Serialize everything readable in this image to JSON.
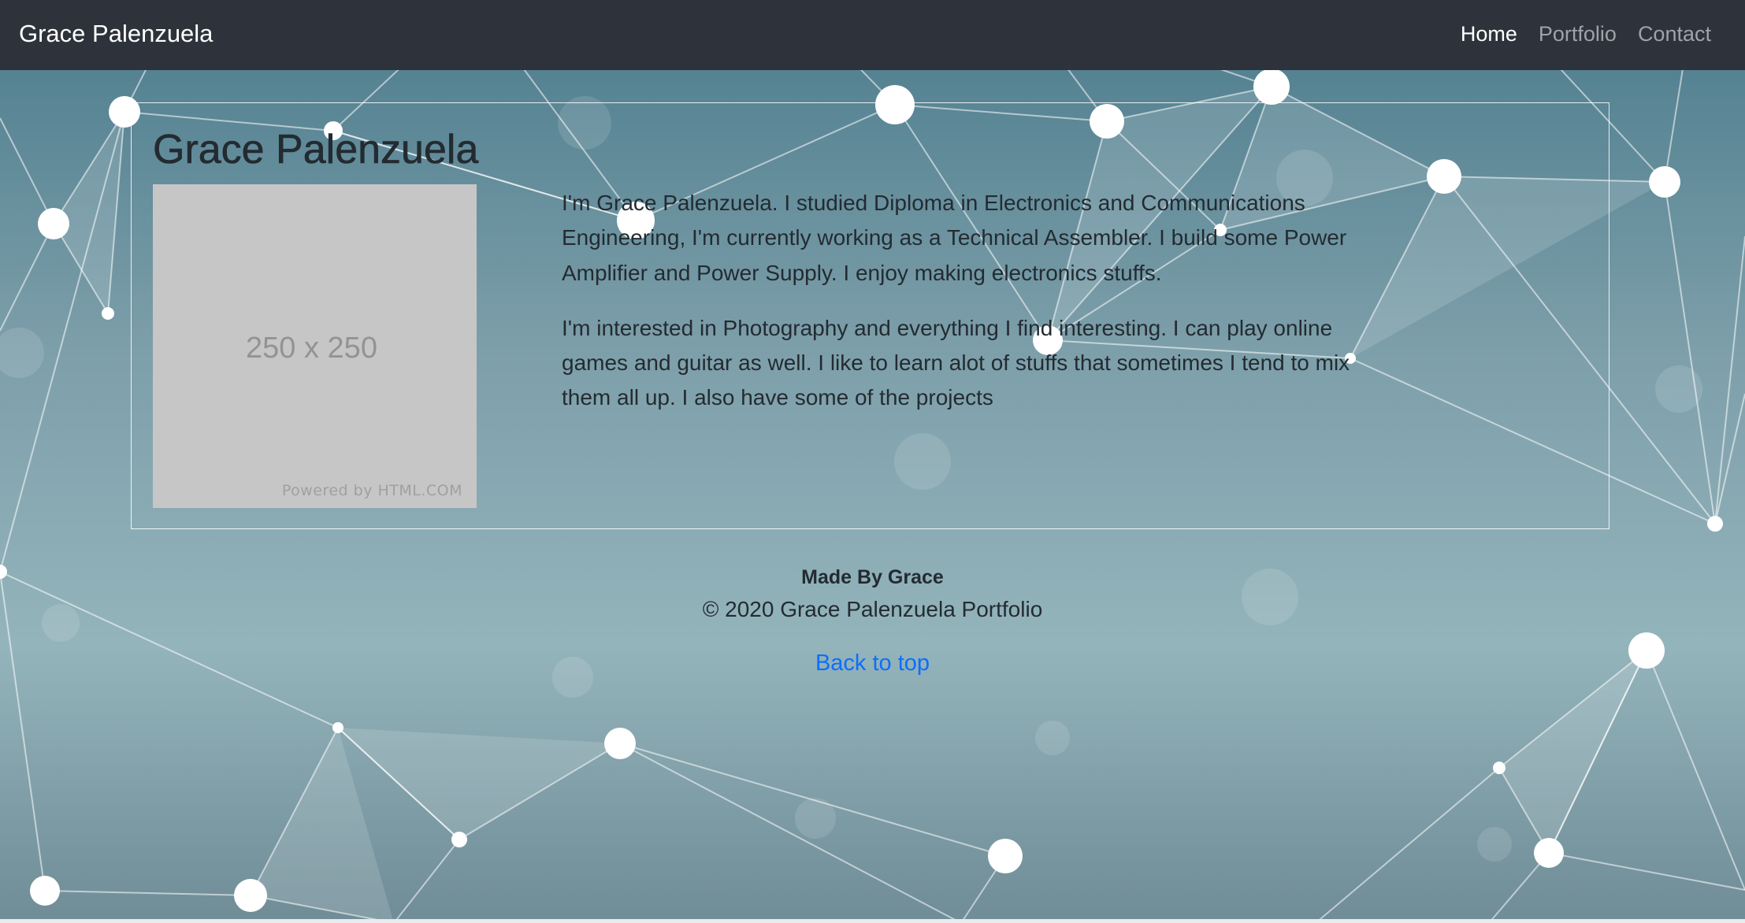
{
  "navbar": {
    "brand": "Grace Palenzuela",
    "links": [
      {
        "label": "Home",
        "active": true
      },
      {
        "label": "Portfolio",
        "active": false
      },
      {
        "label": "Contact",
        "active": false
      }
    ]
  },
  "bio": {
    "title": "Grace Palenzuela",
    "photo": {
      "size_text": "250 x 250",
      "credit": "Powered by HTML.COM"
    },
    "paragraphs": [
      "I'm Grace Palenzuela. I studied Diploma in Electronics and Communications Engineering, I'm currently working as a Technical Assembler. I build some Power Amplifier and Power Supply. I enjoy making electronics stuffs.",
      "I'm interested in Photography and everything I find interesting. I can play online games and guitar as well. I like to learn alot of stuffs that sometimes I tend to mix them all up. I also have some of the projects"
    ]
  },
  "footer": {
    "made_by": "Made By Grace",
    "copyright": "© 2020 Grace Palenzuela Portfolio",
    "back_to_top": "Back to top"
  },
  "colors": {
    "navbar_bg": "#2d323b",
    "link_blue": "#0d6efd",
    "text_dark": "#232b31",
    "placeholder_gray": "#c6c6c6"
  }
}
